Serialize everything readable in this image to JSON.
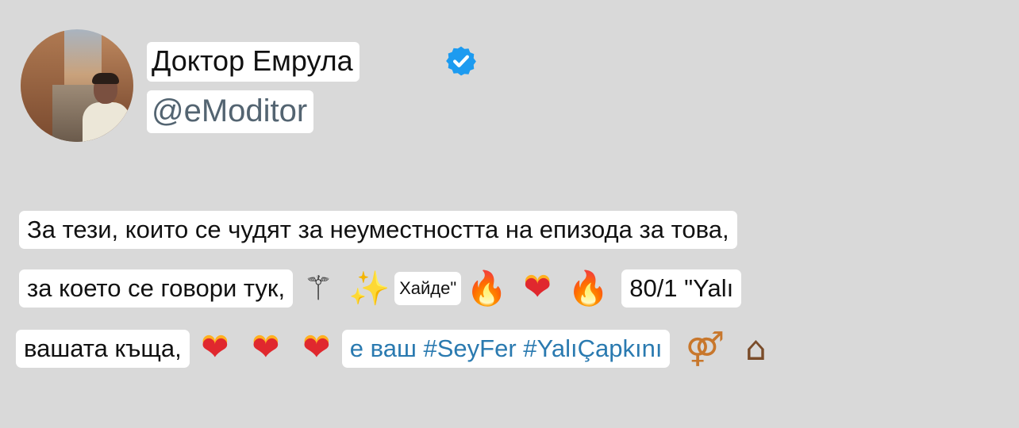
{
  "author": {
    "name": "Доктор Емрула",
    "handle": "@eModitor",
    "verified": true,
    "verified_color": "#1d9bf0"
  },
  "tweet": {
    "line1": "За тези, които се чудят за неуместността на епизода за това,",
    "line2_text": "за което се говори тук,",
    "line2_small": "Хайде\"",
    "line2_tail": "80/1 \"Yalı",
    "line3_text": "вашата къща,",
    "line3_link": "е ваш #SeyFer #YalıÇapkını"
  },
  "icons": {
    "wand": "magic-wand-icon",
    "sparkles": "sparkles-icon",
    "fire": "fire-icon",
    "heart_on_fire": "heart-on-fire-icon",
    "couple": "couple-icon",
    "house": "house-with-garden-icon"
  },
  "colors": {
    "background": "#d9d9d9",
    "link": "#2a7ab0",
    "handle": "#536471"
  }
}
